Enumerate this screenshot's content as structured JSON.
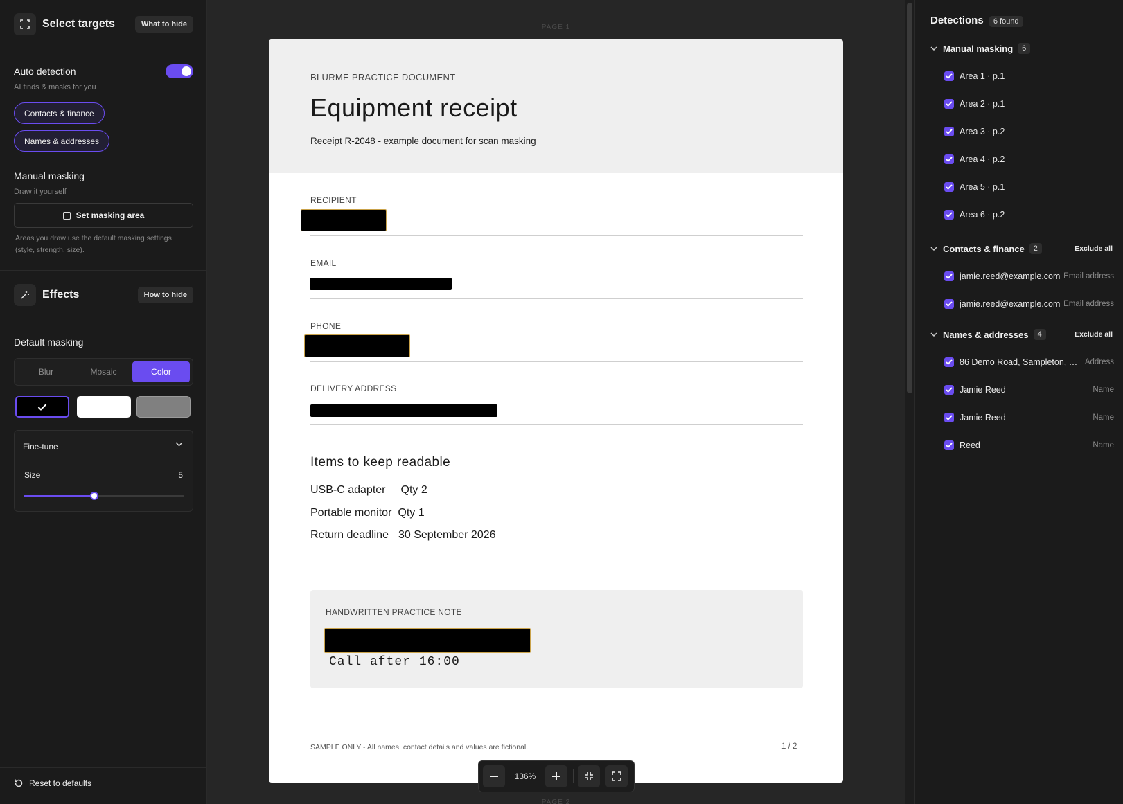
{
  "left": {
    "title": "Select targets",
    "what_to_hide": "What to hide",
    "auto_detection": "Auto detection",
    "auto_detection_sub": "AI finds & masks for you",
    "pills": [
      "Contacts & finance",
      "Names & addresses"
    ],
    "manual_masking": "Manual masking",
    "manual_sub": "Draw it yourself",
    "set_area": "Set masking area",
    "hint": "Areas you draw use the default masking settings (style, strength, size).",
    "effects": "Effects",
    "how_to_hide": "How to hide",
    "default_masking": "Default masking",
    "modes": [
      "Blur",
      "Mosaic",
      "Color"
    ],
    "active_mode": "Color",
    "swatch_colors": [
      "#000000",
      "#ffffff",
      "#808080"
    ],
    "fine_tune": "Fine-tune",
    "size_label": "Size",
    "size_value": "5",
    "size_fraction": 0.44,
    "reset": "Reset to defaults"
  },
  "doc": {
    "page_label_top": "PAGE 1",
    "page_label_bottom": "PAGE 2",
    "eyebrow": "BLURME PRACTICE DOCUMENT",
    "title": "Equipment receipt",
    "subtitle": "Receipt R-2048 - example document for scan masking",
    "fields": [
      "RECIPIENT",
      "EMAIL",
      "PHONE",
      "DELIVERY ADDRESS"
    ],
    "items_title": "Items to keep readable",
    "items": [
      {
        "k": "USB-C adapter",
        "v": "Qty 2"
      },
      {
        "k": "Portable monitor",
        "v": "Qty 1"
      },
      {
        "k": "Return deadline",
        "v": "30 September 2026"
      }
    ],
    "note_label": "HANDWRITTEN PRACTICE NOTE",
    "note_text": "Call after 16:00",
    "footer_left": "SAMPLE ONLY - All names, contact details and values are fictional.",
    "footer_right": "1 / 2"
  },
  "zoom": {
    "value": "136%"
  },
  "right": {
    "title": "Detections",
    "found": "6 found",
    "groups": [
      {
        "title": "Manual masking",
        "count": "6",
        "items": [
          {
            "label": "Area 1 · p.1",
            "type": ""
          },
          {
            "label": "Area 2 · p.1",
            "type": ""
          },
          {
            "label": "Area 3 · p.2",
            "type": ""
          },
          {
            "label": "Area 4 · p.2",
            "type": ""
          },
          {
            "label": "Area 5 · p.1",
            "type": ""
          },
          {
            "label": "Area 6 · p.2",
            "type": ""
          }
        ]
      },
      {
        "title": "Contacts & finance",
        "count": "2",
        "exclude": "Exclude all",
        "items": [
          {
            "label": "jamie.reed@example.com",
            "type": "Email address"
          },
          {
            "label": "jamie.reed@example.com",
            "type": "Email address"
          }
        ]
      },
      {
        "title": "Names & addresses",
        "count": "4",
        "exclude": "Exclude all",
        "items": [
          {
            "label": "86 Demo Road, Sampleton, 2...",
            "type": "Address"
          },
          {
            "label": "Jamie Reed",
            "type": "Name"
          },
          {
            "label": "Jamie Reed",
            "type": "Name"
          },
          {
            "label": "Reed",
            "type": "Name"
          }
        ]
      }
    ]
  }
}
